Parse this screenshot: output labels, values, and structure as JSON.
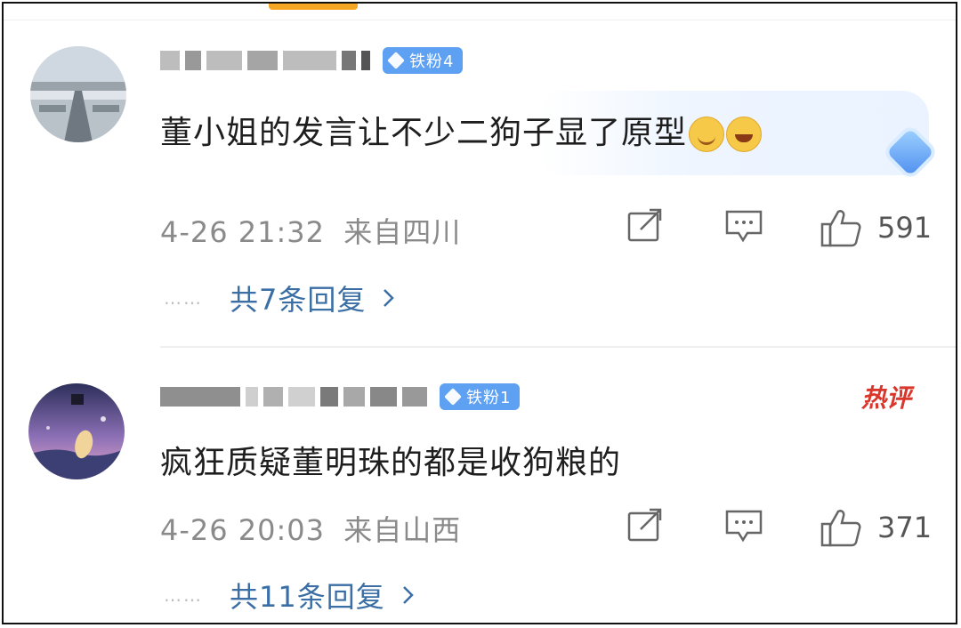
{
  "comments": [
    {
      "badge": "铁粉4",
      "text": "董小姐的发言让不少二狗子显了原型",
      "emojis": [
        "smile-emoji",
        "laugh-emoji"
      ],
      "timestamp": "4-26 21:32",
      "location": "来自四川",
      "likes": "591",
      "dots": "……",
      "replies_label": "共7条回复"
    },
    {
      "badge": "铁粉1",
      "hot_label": "热评",
      "text": "疯狂质疑董明珠的都是收狗粮的",
      "timestamp": "4-26 20:03",
      "location": "来自山西",
      "likes": "371",
      "dots": "……",
      "replies_label": "共11条回复"
    }
  ],
  "colors": {
    "accent_tab": "#f5a623",
    "badge_blue": "#5ea0f2",
    "reply_link": "#3a6ea5",
    "hot_red": "#d9362c",
    "meta_gray": "#8a8a8a"
  }
}
